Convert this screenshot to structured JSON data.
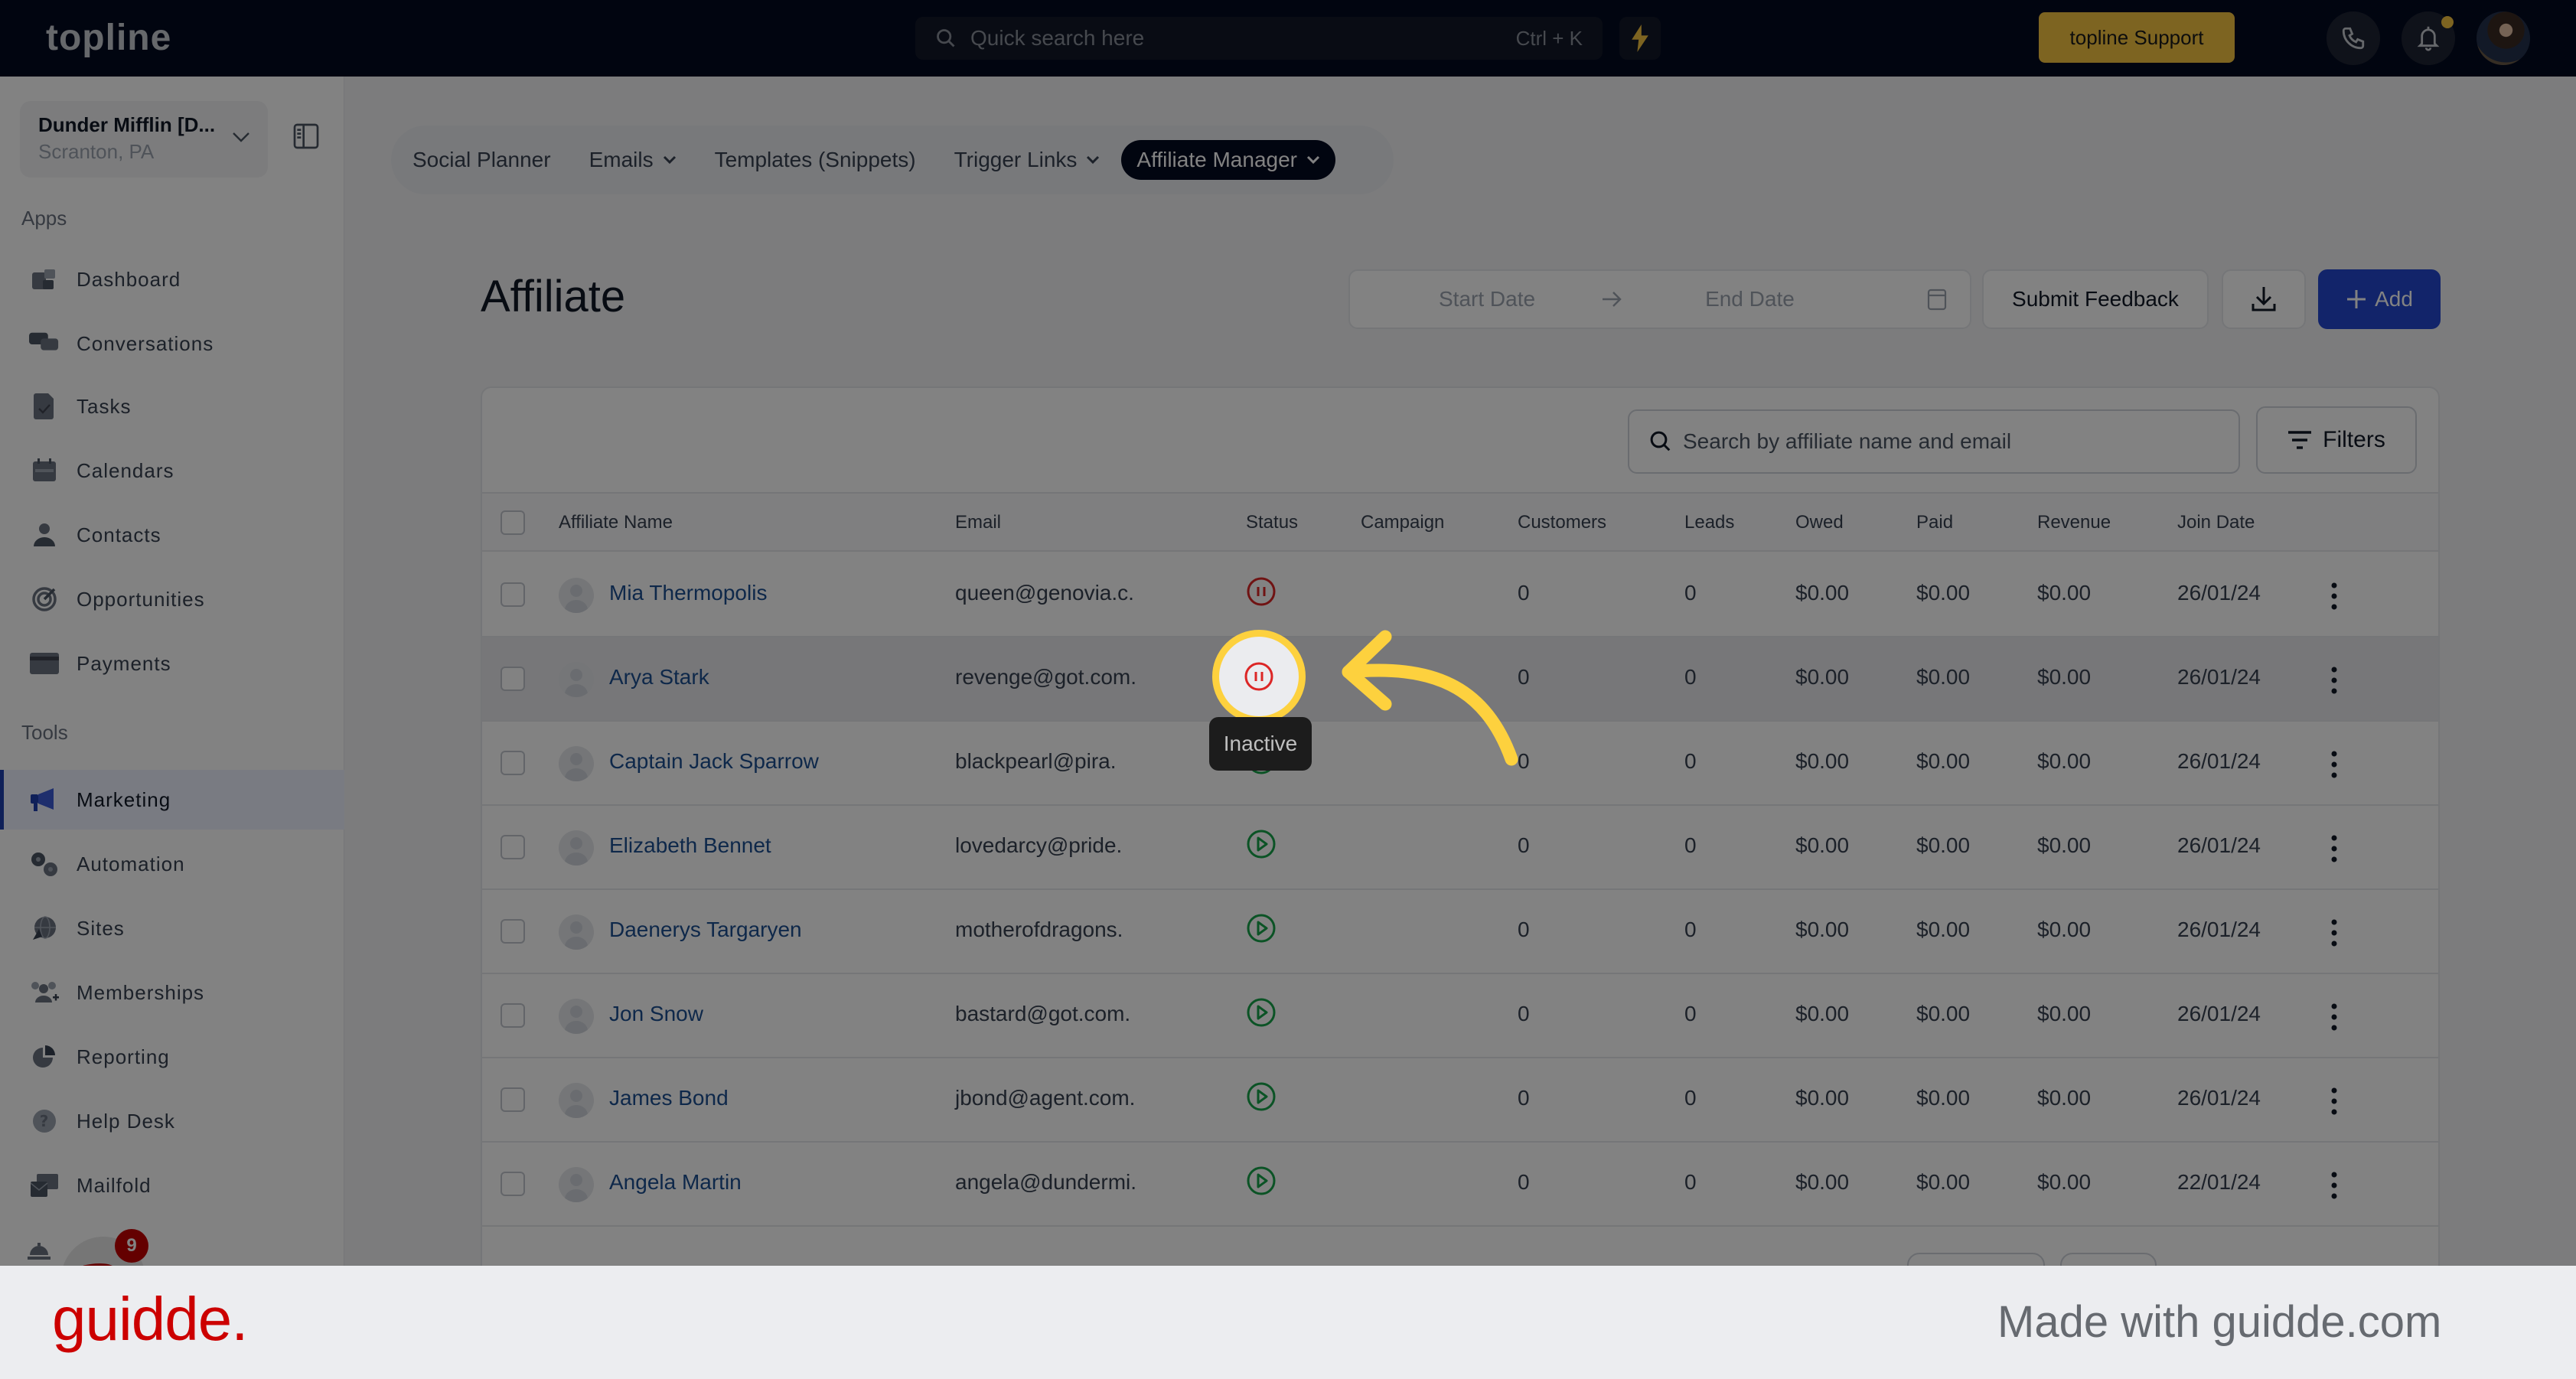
{
  "topbar": {
    "brand": "topline",
    "search_placeholder": "Quick search here",
    "search_shortcut": "Ctrl + K",
    "support_label": "topline Support",
    "accent_color": "#f5c542"
  },
  "location": {
    "name": "Dunder Mifflin [D...",
    "subtitle": "Scranton, PA"
  },
  "sidebar": {
    "apps_label": "Apps",
    "tools_label": "Tools",
    "apps": [
      {
        "label": "Dashboard",
        "icon": "dashboard-icon"
      },
      {
        "label": "Conversations",
        "icon": "chat-bubbles-icon"
      },
      {
        "label": "Tasks",
        "icon": "task-check-icon"
      },
      {
        "label": "Calendars",
        "icon": "calendar-icon"
      },
      {
        "label": "Contacts",
        "icon": "person-icon"
      },
      {
        "label": "Opportunities",
        "icon": "target-icon"
      },
      {
        "label": "Payments",
        "icon": "credit-card-icon"
      }
    ],
    "tools": [
      {
        "label": "Marketing",
        "icon": "megaphone-icon",
        "active": true
      },
      {
        "label": "Automation",
        "icon": "gears-icon"
      },
      {
        "label": "Sites",
        "icon": "globe-cursor-icon"
      },
      {
        "label": "Memberships",
        "icon": "users-plus-icon"
      },
      {
        "label": "Reporting",
        "icon": "pie-chart-icon"
      },
      {
        "label": "Help Desk",
        "icon": "question-icon"
      },
      {
        "label": "Mailfold",
        "icon": "mail-stack-icon"
      }
    ],
    "widget_badge": "9"
  },
  "subnav": {
    "tabs": [
      {
        "label": "Social Planner",
        "dropdown": false
      },
      {
        "label": "Emails",
        "dropdown": true
      },
      {
        "label": "Templates (Snippets)",
        "dropdown": false
      },
      {
        "label": "Trigger Links",
        "dropdown": true
      },
      {
        "label": "Affiliate Manager",
        "dropdown": true,
        "active": true
      }
    ]
  },
  "page": {
    "title": "Affiliate",
    "start_date_placeholder": "Start Date",
    "end_date_placeholder": "End Date",
    "submit_feedback_label": "Submit Feedback",
    "add_label": "Add",
    "primary_color": "#2547d0"
  },
  "table": {
    "search_placeholder": "Search by affiliate name and email",
    "filters_label": "Filters",
    "columns": [
      "Affiliate Name",
      "Email",
      "Status",
      "Campaign",
      "Customers",
      "Leads",
      "Owed",
      "Paid",
      "Revenue",
      "Join Date"
    ],
    "rows": [
      {
        "name": "Mia Thermopolis",
        "email": "queen@genovia.c.",
        "status": "inactive",
        "campaign": "",
        "customers": "0",
        "leads": "0",
        "owed": "$0.00",
        "paid": "$0.00",
        "revenue": "$0.00",
        "join_date": "26/01/24"
      },
      {
        "name": "Arya Stark",
        "email": "revenge@got.com.",
        "status": "inactive",
        "campaign": "",
        "customers": "0",
        "leads": "0",
        "owed": "$0.00",
        "paid": "$0.00",
        "revenue": "$0.00",
        "join_date": "26/01/24"
      },
      {
        "name": "Captain Jack Sparrow",
        "email": "blackpearl@pira.",
        "status": "active",
        "campaign": "",
        "customers": "0",
        "leads": "0",
        "owed": "$0.00",
        "paid": "$0.00",
        "revenue": "$0.00",
        "join_date": "26/01/24"
      },
      {
        "name": "Elizabeth Bennet",
        "email": "lovedarcy@pride.",
        "status": "active",
        "campaign": "",
        "customers": "0",
        "leads": "0",
        "owed": "$0.00",
        "paid": "$0.00",
        "revenue": "$0.00",
        "join_date": "26/01/24"
      },
      {
        "name": "Daenerys Targaryen",
        "email": "motherofdragons.",
        "status": "active",
        "campaign": "",
        "customers": "0",
        "leads": "0",
        "owed": "$0.00",
        "paid": "$0.00",
        "revenue": "$0.00",
        "join_date": "26/01/24"
      },
      {
        "name": "Jon Snow",
        "email": "bastard@got.com.",
        "status": "active",
        "campaign": "",
        "customers": "0",
        "leads": "0",
        "owed": "$0.00",
        "paid": "$0.00",
        "revenue": "$0.00",
        "join_date": "26/01/24"
      },
      {
        "name": "James Bond",
        "email": "jbond@agent.com.",
        "status": "active",
        "campaign": "",
        "customers": "0",
        "leads": "0",
        "owed": "$0.00",
        "paid": "$0.00",
        "revenue": "$0.00",
        "join_date": "26/01/24"
      },
      {
        "name": "Angela Martin",
        "email": "angela@dundermi.",
        "status": "active",
        "campaign": "",
        "customers": "0",
        "leads": "0",
        "owed": "$0.00",
        "paid": "$0.00",
        "revenue": "$0.00",
        "join_date": "22/01/24"
      }
    ],
    "status_colors": {
      "inactive": "#dc2626",
      "active": "#16a34a"
    }
  },
  "callout": {
    "tooltip": "Inactive",
    "highlight_color": "#fdd13e"
  },
  "footer": {
    "logo": "guidde.",
    "tagline": "Made with guidde.com",
    "logo_color": "#cc0000"
  }
}
